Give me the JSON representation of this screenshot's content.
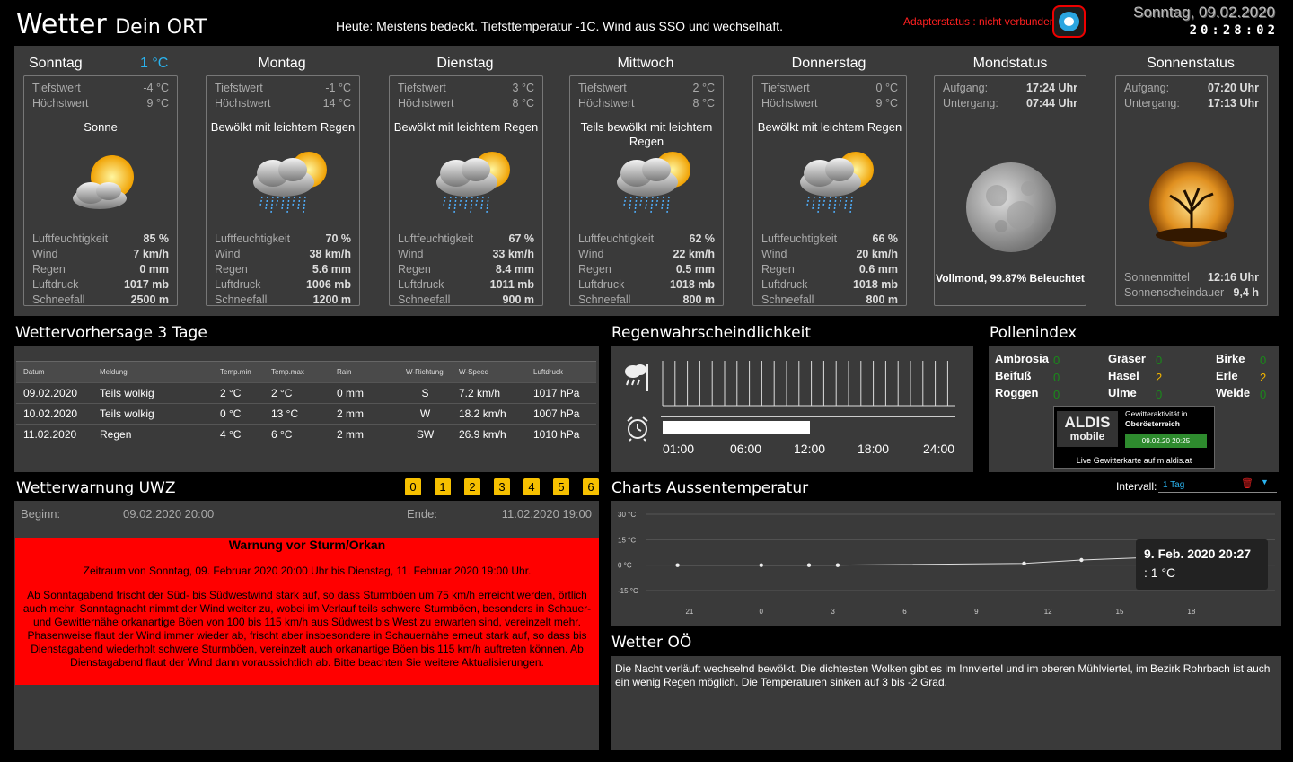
{
  "header": {
    "title": "Wetter",
    "place": "Dein ORT",
    "today_summary": "Heute: Meistens bedeckt. Tiefsttemperatur -1C. Wind aus SSO und wechselhaft.",
    "adapter_status": "Adapterstatus : nicht verbunden",
    "date": "Sonntag, 09.02.2020",
    "time": "20:28:02"
  },
  "days": [
    {
      "name": "Sonntag",
      "current_temp": "1 °C",
      "tief_label": "Tiefstwert",
      "tief": "-4 °C",
      "hoch_label": "Höchstwert",
      "hoch": "9 °C",
      "condition": "Sonne",
      "icon": "sun-cloud-icon",
      "lf_label": "Luftfeuchtigkeit",
      "lf": "85 %",
      "wind_label": "Wind",
      "wind": "7 km/h",
      "regen_label": "Regen",
      "regen": "0 mm",
      "druck_label": "Luftdruck",
      "druck": "1017 mb",
      "schnee_label": "Schneefall",
      "schnee": "2500 m"
    },
    {
      "name": "Montag",
      "tief_label": "Tiefstwert",
      "tief": "-1 °C",
      "hoch_label": "Höchstwert",
      "hoch": "14 °C",
      "condition": "Bewölkt mit leichtem Regen",
      "icon": "rain-cloud-icon",
      "lf_label": "Luftfeuchtigkeit",
      "lf": "70 %",
      "wind_label": "Wind",
      "wind": "38 km/h",
      "regen_label": "Regen",
      "regen": "5.6 mm",
      "druck_label": "Luftdruck",
      "druck": "1006 mb",
      "schnee_label": "Schneefall",
      "schnee": "1200 m"
    },
    {
      "name": "Dienstag",
      "tief_label": "Tiefstwert",
      "tief": "3 °C",
      "hoch_label": "Höchstwert",
      "hoch": "8 °C",
      "condition": "Bewölkt mit leichtem Regen",
      "icon": "rain-cloud-icon",
      "lf_label": "Luftfeuchtigkeit",
      "lf": "67 %",
      "wind_label": "Wind",
      "wind": "33 km/h",
      "regen_label": "Regen",
      "regen": "8.4 mm",
      "druck_label": "Luftdruck",
      "druck": "1011 mb",
      "schnee_label": "Schneefall",
      "schnee": "900 m"
    },
    {
      "name": "Mittwoch",
      "tief_label": "Tiefstwert",
      "tief": "2 °C",
      "hoch_label": "Höchstwert",
      "hoch": "8 °C",
      "condition": "Teils bewölkt mit leichtem Regen",
      "icon": "rain-cloud-icon",
      "lf_label": "Luftfeuchtigkeit",
      "lf": "62 %",
      "wind_label": "Wind",
      "wind": "22 km/h",
      "regen_label": "Regen",
      "regen": "0.5 mm",
      "druck_label": "Luftdruck",
      "druck": "1018 mb",
      "schnee_label": "Schneefall",
      "schnee": "800 m"
    },
    {
      "name": "Donnerstag",
      "tief_label": "Tiefstwert",
      "tief": "0 °C",
      "hoch_label": "Höchstwert",
      "hoch": "9 °C",
      "condition": "Bewölkt mit leichtem Regen",
      "icon": "rain-cloud-icon",
      "lf_label": "Luftfeuchtigkeit",
      "lf": "66 %",
      "wind_label": "Wind",
      "wind": "20 km/h",
      "regen_label": "Regen",
      "regen": "0.6 mm",
      "druck_label": "Luftdruck",
      "druck": "1018 mb",
      "schnee_label": "Schneefall",
      "schnee": "800 m"
    }
  ],
  "moon": {
    "title": "Mondstatus",
    "rise_label": "Aufgang:",
    "rise": "17:24 Uhr",
    "set_label": "Untergang:",
    "set": "07:44 Uhr",
    "phase": "Vollmond, 99.87% Beleuchtet"
  },
  "sun": {
    "title": "Sonnenstatus",
    "rise_label": "Aufgang:",
    "rise": "07:20 Uhr",
    "set_label": "Untergang:",
    "set": "17:13 Uhr",
    "noon_label": "Sonnenmittel",
    "noon": "12:16 Uhr",
    "duration_label": "Sonnenscheindauer",
    "duration": "9,4 h"
  },
  "forecast3": {
    "title": "Wettervorhersage 3 Tage",
    "columns": [
      "Datum",
      "Meldung",
      "Temp.min",
      "Temp.max",
      "Rain",
      "W-Richtung",
      "W-Speed",
      "Luftdruck"
    ],
    "rows": [
      [
        "09.02.2020",
        "Teils wolkig",
        "2 °C",
        "2 °C",
        "0 mm",
        "S",
        "7.2 km/h",
        "1017 hPa"
      ],
      [
        "10.02.2020",
        "Teils wolkig",
        "0 °C",
        "13 °C",
        "2 mm",
        "W",
        "18.2 km/h",
        "1007 hPa"
      ],
      [
        "11.02.2020",
        "Regen",
        "4 °C",
        "6 °C",
        "2 mm",
        "SW",
        "26.9 km/h",
        "1010 hPa"
      ]
    ]
  },
  "rain": {
    "title": "Regenwahrscheindlichkeit",
    "times": [
      "01:00",
      "06:00",
      "12:00",
      "18:00",
      "24:00"
    ],
    "bar_fraction": 0.5
  },
  "pollen": {
    "title": "Pollenindex",
    "items": [
      {
        "name": "Ambrosia",
        "value": "0",
        "color": "#1a8a1a"
      },
      {
        "name": "Beifuß",
        "value": "0",
        "color": "#1a8a1a"
      },
      {
        "name": "Roggen",
        "value": "0",
        "color": "#1a8a1a"
      },
      {
        "name": "Gräser",
        "value": "0",
        "color": "#1a8a1a"
      },
      {
        "name": "Hasel",
        "value": "2",
        "color": "#f0b400"
      },
      {
        "name": "Ulme",
        "value": "0",
        "color": "#1a8a1a"
      },
      {
        "name": "Birke",
        "value": "0",
        "color": "#1a8a1a"
      },
      {
        "name": "Erle",
        "value": "2",
        "color": "#f0b400"
      },
      {
        "name": "Weide",
        "value": "0",
        "color": "#1a8a1a"
      }
    ],
    "aldis": {
      "logo": "ALDIS",
      "logo_sub": "mobile",
      "line1": "Gewitteraktivität in",
      "line2": "Oberösterreich",
      "date": "09.02.20 20:25",
      "footer": "Live Gewitterkarte auf m.aldis.at"
    }
  },
  "uwz": {
    "title": "Wetterwarnung UWZ",
    "levels": [
      "0",
      "1",
      "2",
      "3",
      "4",
      "5",
      "6"
    ],
    "begin_label": "Beginn:",
    "begin": "09.02.2020 20:00",
    "end_label": "Ende:",
    "end": "11.02.2020 19:00",
    "headline": "Warnung vor Sturm/Orkan",
    "period": "Zeitraum von Sonntag, 09. Februar 2020 20:00 Uhr bis Dienstag, 11. Februar 2020 19:00 Uhr.",
    "body": "Ab Sonntagabend frischt der Süd- bis Südwestwind stark auf, so dass Sturmböen um 75 km/h erreicht werden, örtlich auch mehr. Sonntagnacht nimmt der Wind weiter zu, wobei im Verlauf teils schwere Sturmböen, besonders in Schauer- und Gewitternähe orkanartige Böen von 100 bis 115 km/h aus Südwest bis West zu erwarten sind, vereinzelt mehr. Phasenweise flaut der Wind immer wieder ab, frischt aber insbesondere in Schauernähe erneut stark auf, so dass bis Dienstagabend wiederholt schwere Sturmböen, vereinzelt auch orkanartige Böen bis 115 km/h auftreten können. Ab Dienstagabend flaut der Wind dann voraussichtlich ab. Bitte beachten Sie weitere Aktualisierungen."
  },
  "charts": {
    "title": "Charts Aussentemperatur",
    "interval_label": "Intervall:",
    "interval_value": "1 Tag",
    "tooltip_title": "9. Feb. 2020 20:27",
    "tooltip_value": ": 1 °C"
  },
  "chart_data": {
    "type": "line",
    "yticks": [
      "30 °C",
      "15 °C",
      "0 °C",
      "-15 °C"
    ],
    "ylim": [
      -15,
      30
    ],
    "xticks": [
      "21",
      "0",
      "3",
      "6",
      "9",
      "12",
      "15",
      "18"
    ],
    "x_hours": [
      -3.5,
      0,
      2,
      3.2,
      11,
      13.4,
      16.3,
      20.45
    ],
    "values": [
      0,
      0,
      0,
      0,
      1,
      3,
      4.5,
      1
    ]
  },
  "wetter_oo": {
    "title": "Wetter OÖ",
    "text": "Die Nacht verläuft wechselnd bewölkt. Die dichtesten Wolken gibt es im Innviertel und im oberen Mühlviertel, im Bezirk Rohrbach ist auch ein wenig Regen möglich. Die Temperaturen sinken auf 3 bis -2 Grad."
  }
}
